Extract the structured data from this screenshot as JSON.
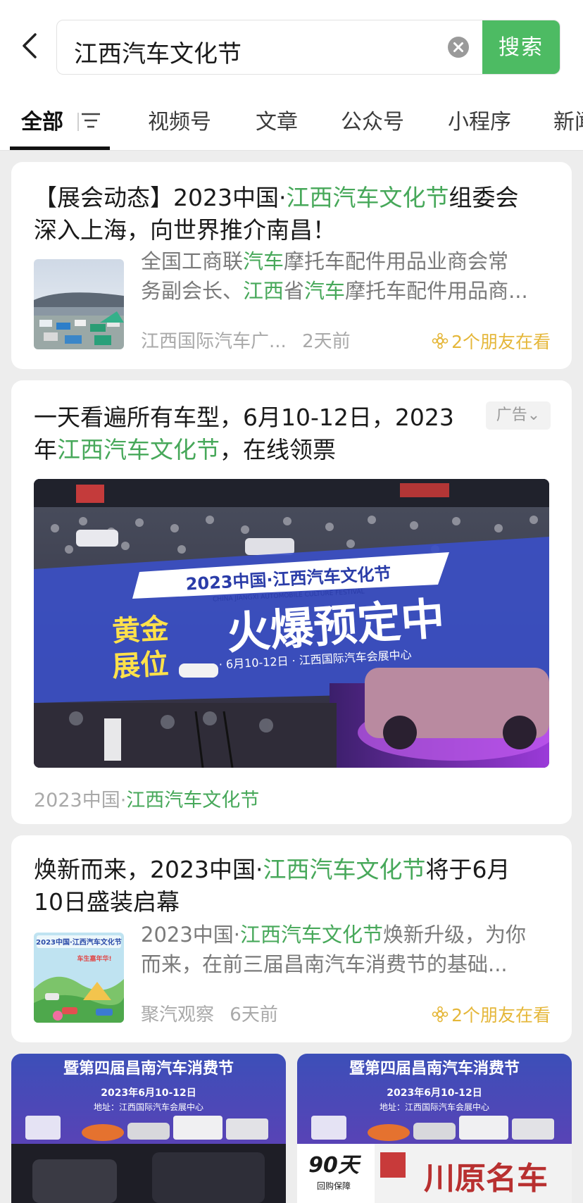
{
  "search": {
    "query": "江西汽车文化节",
    "button_label": "搜索"
  },
  "tabs": [
    {
      "label": "全部"
    },
    {
      "label": "视频号"
    },
    {
      "label": "文章"
    },
    {
      "label": "公众号"
    },
    {
      "label": "小程序"
    },
    {
      "label": "新闻"
    }
  ],
  "results": {
    "r1": {
      "title_a": "【展会动态】2023中国·",
      "title_hl": "江西汽车文化节",
      "title_b": "组委会",
      "title_line2": "深入上海，向世界推介南昌！",
      "desc_l1_a": "全国工商联",
      "desc_l1_hl": "汽车",
      "desc_l1_b": "摩托车配件用品业商会常",
      "desc_l2_a": "务副会长、",
      "desc_l2_hl1": "江西",
      "desc_l2_b": "省",
      "desc_l2_hl2": "汽车",
      "desc_l2_c": "摩托车配件用品商...",
      "source": "江西国际汽车广...",
      "time": "2天前",
      "friends": "2个朋友在看"
    },
    "r2": {
      "title_line1": "一天看遍所有车型，6月10-12日，2023",
      "title_l2_a": "年",
      "title_l2_hl": "江西汽车文化节",
      "title_l2_b": "，在线领票",
      "ad_label": "广告",
      "banner_header": "2023中国·江西汽车文化节",
      "banner_sub": "CHINA JIANGXI AUTOMOBILE CULTURE FESTIVAL",
      "banner_gold_1": "黄金",
      "banner_gold_2": "展位",
      "banner_main": "火爆预定中",
      "banner_info": "· 6月10-12日 · 江西国际汽车会展中心",
      "source_a": "2023中国·",
      "source_hl": "江西汽车文化节"
    },
    "r3": {
      "title_a": "焕新而来，2023中国·",
      "title_hl": "江西汽车文化节",
      "title_b": "将于6月",
      "title_line2": "10日盛装启幕",
      "thumb_title": "2023中国·江西汽车文化节",
      "thumb_slogan": "车生嘉年华!",
      "desc_l1_a": "2023中国·",
      "desc_l1_hl": "江西汽车文化节",
      "desc_l1_b": "焕新升级，为你",
      "desc_l2": "而来，在前三届昌南汽车消费节的基础...",
      "source": "聚汽观察",
      "time": "6天前",
      "friends": "2个朋友在看"
    }
  },
  "bottom_videos": {
    "header": "暨第四届昌南汽车消费节",
    "date": "2023年6月10-12日",
    "address": "地址：江西国际汽车会展中心",
    "right_badge_num": "90天",
    "right_badge_text": "回购保障",
    "right_brand": "川原名车"
  }
}
